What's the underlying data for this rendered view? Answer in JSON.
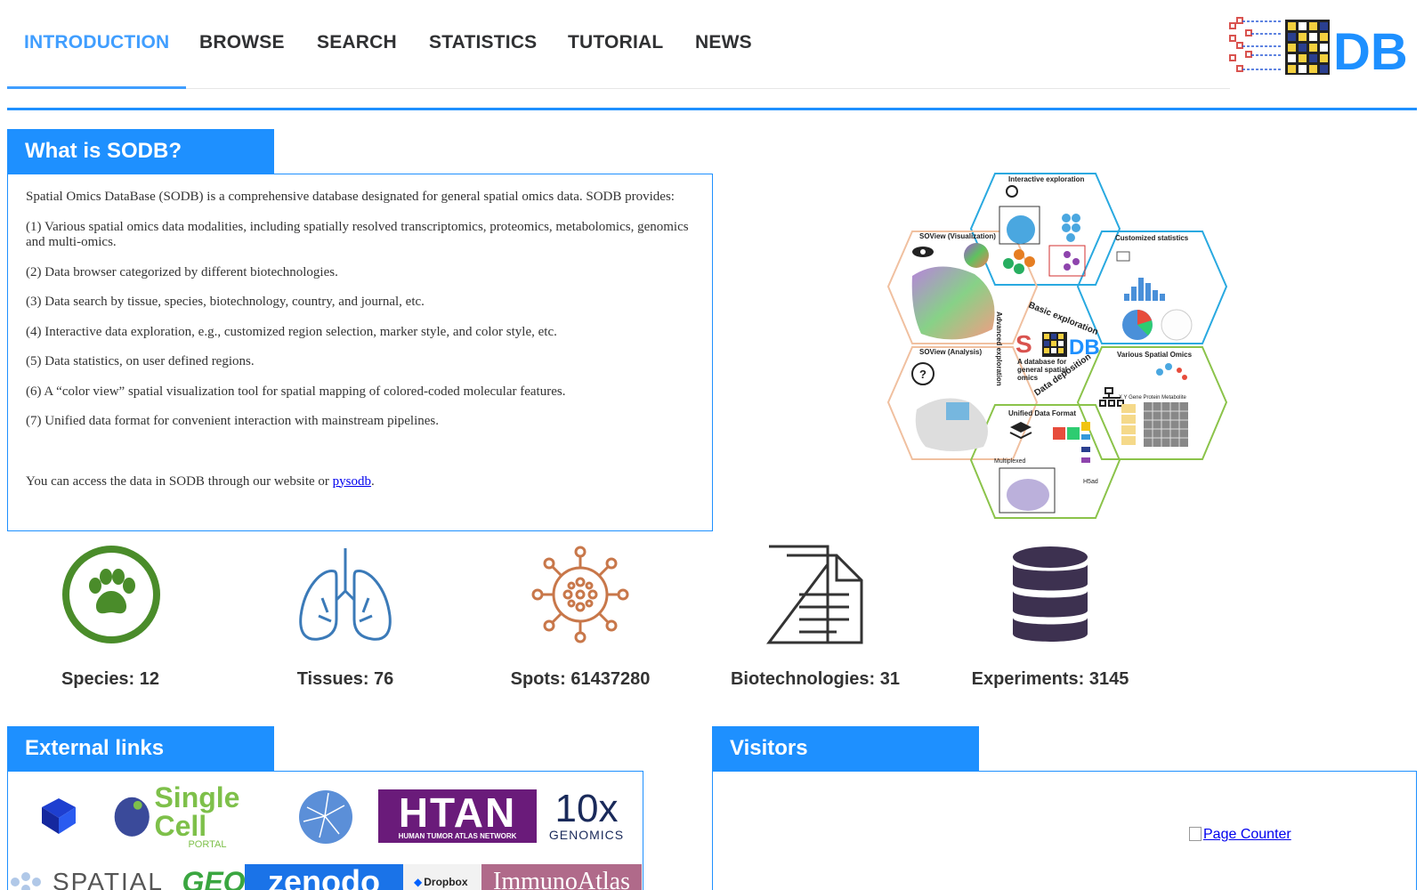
{
  "nav": {
    "items": [
      {
        "label": "INTRODUCTION",
        "active": true
      },
      {
        "label": "BROWSE"
      },
      {
        "label": "SEARCH"
      },
      {
        "label": "STATISTICS"
      },
      {
        "label": "TUTORIAL"
      },
      {
        "label": "NEWS"
      }
    ],
    "accent": "#409eff",
    "logo_text": "DB"
  },
  "intro": {
    "title": "What is SODB?",
    "lead": "Spatial Omics DataBase (SODB) is a comprehensive database designated for general spatial omics data. SODB provides:",
    "features": [
      "(1) Various spatial omics data modalities, including spatially resolved transcriptomics, proteomics, metabolomics, genomics and multi-omics.",
      "(2) Data browser categorized by different biotechnologies.",
      "(3) Data search by tissue, species, biotechnology, country, and journal, etc.",
      "(4) Interactive data exploration, e.g., customized region selection, marker style, and color style, etc.",
      "(5) Data statistics, on user defined regions.",
      "(6) A “color view” spatial visualization tool for spatial mapping of colored-coded molecular features.",
      "(7) Unified data format for convenient interaction with mainstream pipelines."
    ],
    "access_prefix": "You can access the data in SODB through our website or ",
    "access_link": "pysodb",
    "access_suffix": "."
  },
  "figure": {
    "cells": {
      "interactive": "Interactive exploration",
      "customized": "Customized statistics",
      "soview_vis": "SOView (Visualization)",
      "soview_analysis": "SOView (Analysis)",
      "various": "Various Spatial Omics",
      "unified": "Unified Data Format",
      "basic": "Basic exploration",
      "advanced": "Advanced exploration",
      "deposition": "Data deposition",
      "center": "A database for general spatial omics",
      "center_logo": "DB",
      "multiplexed": "Multiplexed",
      "h5ad": "H5ad",
      "omics_cols": "X  Y  Gene Protein Metabolite"
    }
  },
  "stats": [
    {
      "label": "Species: 12",
      "icon": "paw-icon",
      "color": "#4a8c2a"
    },
    {
      "label": "Tissues: 76",
      "icon": "lungs-icon",
      "color": "#3b7ab8"
    },
    {
      "label": "Spots: 61437280",
      "icon": "virus-icon",
      "color": "#c8774a"
    },
    {
      "label": "Biotechnologies: 31",
      "icon": "document-icon",
      "color": "#333333"
    },
    {
      "label": "Experiments: 3145",
      "icon": "database-icon",
      "color": "#3d3150"
    }
  ],
  "external": {
    "title": "External links",
    "logos": [
      "Single Cell",
      "PORTAL",
      "HTAN",
      "HUMAN TUMOR ATLAS NETWORK",
      "10x",
      "GENOMICS",
      "SPATIAL",
      "GEO",
      "zenodo",
      "Dropbox",
      "ImmunoAtlas"
    ]
  },
  "visitors": {
    "title": "Visitors",
    "counter_alt": "Page Counter"
  }
}
